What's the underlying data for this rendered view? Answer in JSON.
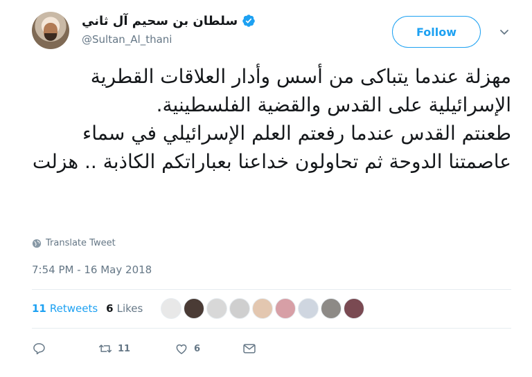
{
  "user": {
    "display_name": "سلطان بن سحيم آل ثاني",
    "handle": "@Sultan_Al_thani",
    "verified": true
  },
  "follow_label": "Follow",
  "tweet": {
    "paragraphs": [
      "مهزلة عندما يتباكى من أسس وأدار العلاقات القطرية الإسرائيلية على القدس والقضية الفلسطينية.",
      "طعنتم القدس عندما رفعتم العلم الإسرائيلي في سماء عاصمتنا الدوحة ثم تحاولون خداعنا بعباراتكم الكاذبة .. هزلت"
    ]
  },
  "translate_label": "Translate Tweet",
  "timestamp": "7:54 PM - 16 May 2018",
  "stats": {
    "retweets_count": "11",
    "retweets_label": "Retweets",
    "likes_count": "6",
    "likes_label": "Likes"
  },
  "engager_avatar_colors": [
    "#e8e8e8",
    "#4a3b35",
    "#d8d8d8",
    "#cfcfcf",
    "#e3c7b0",
    "#d79fa6",
    "#cfd6e0",
    "#8d8a86",
    "#7a4a52"
  ],
  "actions": {
    "reply_count": "",
    "retweet_count": "11",
    "like_count": "6"
  },
  "colors": {
    "accent": "#1da1f2",
    "secondary_text": "#657786",
    "divider": "#e6ecf0"
  }
}
